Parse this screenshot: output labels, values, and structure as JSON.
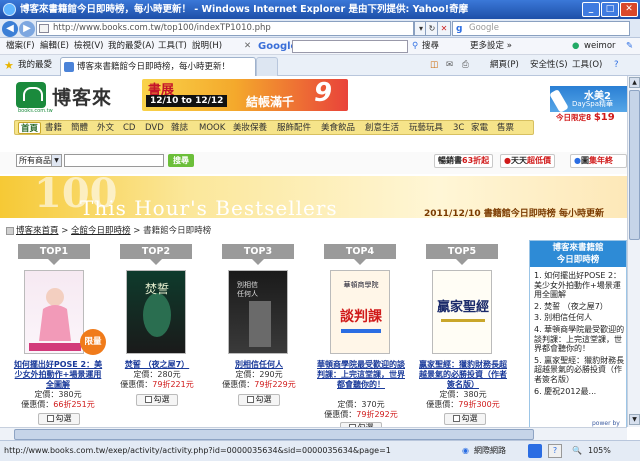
{
  "window": {
    "title": "博客來書籍館今日即時榜，每小時更新！ - Windows Internet Explorer 是由下列提供: Yahoo!奇摩"
  },
  "address": {
    "url": "http://www.books.com.tw/top100/indexTP1010.php",
    "search_placeholder": "Google"
  },
  "menu": [
    "檔案(F)",
    "編輯(E)",
    "檢視(V)",
    "我的最愛(A)",
    "工具(T)",
    "說明(H)"
  ],
  "google_toolbar": {
    "logo": "Google",
    "search_label": "搜尋",
    "more_label": "更多設定 »",
    "user": "weimor"
  },
  "favorites": {
    "label": "我的最愛",
    "tab_title": "博客來書籍館今日即時榜，每小時更新！"
  },
  "command_bar": {
    "page": "網頁(P)",
    "safety": "安全性(S)",
    "tools": "工具(O)"
  },
  "site": {
    "logo_text": "博客來",
    "logo_sub": "books.com.tw",
    "banner": {
      "line1": "書展",
      "dates": "12/10 to 12/12",
      "line2": "結帳滿千",
      "badge": "9折"
    },
    "ad": {
      "brand": "水美2",
      "product": "DaySpa精華",
      "deal_label": "今日限定8",
      "deal_price": "$19"
    },
    "categories": [
      "首頁",
      "書籍",
      "簡體",
      "外文",
      "CD",
      "DVD",
      "雜誌",
      "MOOK",
      "美妝保養",
      "服飾配件",
      "美食飲品",
      "創意生活",
      "玩藝玩具",
      "3C",
      "家電",
      "售票"
    ],
    "search": {
      "scope": "所有商品",
      "button": "搜尋"
    },
    "promos": [
      {
        "text": "暢銷書",
        "highlight": "63折起"
      },
      {
        "text": "天天",
        "highlight": "超低價"
      },
      {
        "text": "圖",
        "highlight": "集年終"
      }
    ],
    "hero": {
      "big": "100",
      "title": "This Hour's Bestsellers",
      "date": "2011/12/10  書籍館今日即時榜  每小時更新"
    },
    "breadcrumb": [
      "博客來首頁",
      "全館今日即時榜",
      "書籍館今日即時榜"
    ],
    "limited_badge": "限量",
    "books": [
      {
        "rank": "TOP1",
        "title": "如何擺出好POSE 2：美少女外拍動作+場景運用全圖解",
        "list_label": "定價：",
        "list_price": "380元",
        "sale_label": "優惠價：",
        "discount": "66折",
        "sale_price": "251元",
        "select": "勾選"
      },
      {
        "rank": "TOP2",
        "title": "焚誓 （夜之屋7）",
        "list_label": "定價：",
        "list_price": "280元",
        "sale_label": "優惠價：",
        "discount": "79折",
        "sale_price": "221元",
        "select": "勾選"
      },
      {
        "rank": "TOP3",
        "title": "別相信任何人",
        "list_label": "定價：",
        "list_price": "290元",
        "sale_label": "優惠價：",
        "discount": "79折",
        "sale_price": "229元",
        "select": "勾選"
      },
      {
        "rank": "TOP4",
        "title": "華頓商學院最受歡迎的談判課：上完這堂課，世界都會聽你的！",
        "list_label": "定價：",
        "list_price": "370元",
        "sale_label": "優惠價：",
        "discount": "79折",
        "sale_price": "292元",
        "select": "勾選"
      },
      {
        "rank": "TOP5",
        "title": "贏家聖經：獵豹財務長超越景氣的必勝投資（作者簽名版）",
        "list_label": "定價：",
        "list_price": "380元",
        "sale_label": "優惠價：",
        "discount": "79折",
        "sale_price": "300元",
        "select": "勾選"
      }
    ],
    "sidebar": {
      "header_line1": "博客來書籍館",
      "header_line2": "今日即時榜",
      "items": [
        "1. 如何擺出好POSE 2：美少女外拍動作+場景運用全圖解",
        "2. 焚誓 （夜之屋7）",
        "3. 別相信任何人",
        "4. 華頓商學院最受歡迎的談判課：上完這堂課，世界都會聽你的！",
        "5. 贏家聖經：獵豹財務長超越景氣的必勝投資（作者簽名版）",
        "6. 慶祝2012最..."
      ],
      "footer": "power by"
    }
  },
  "status": {
    "url": "http://www.books.com.tw/exep/activity/activity.php?id=0000035634&sid=0000035634&page=1",
    "zone": "網際網路",
    "zoom": "105%"
  }
}
